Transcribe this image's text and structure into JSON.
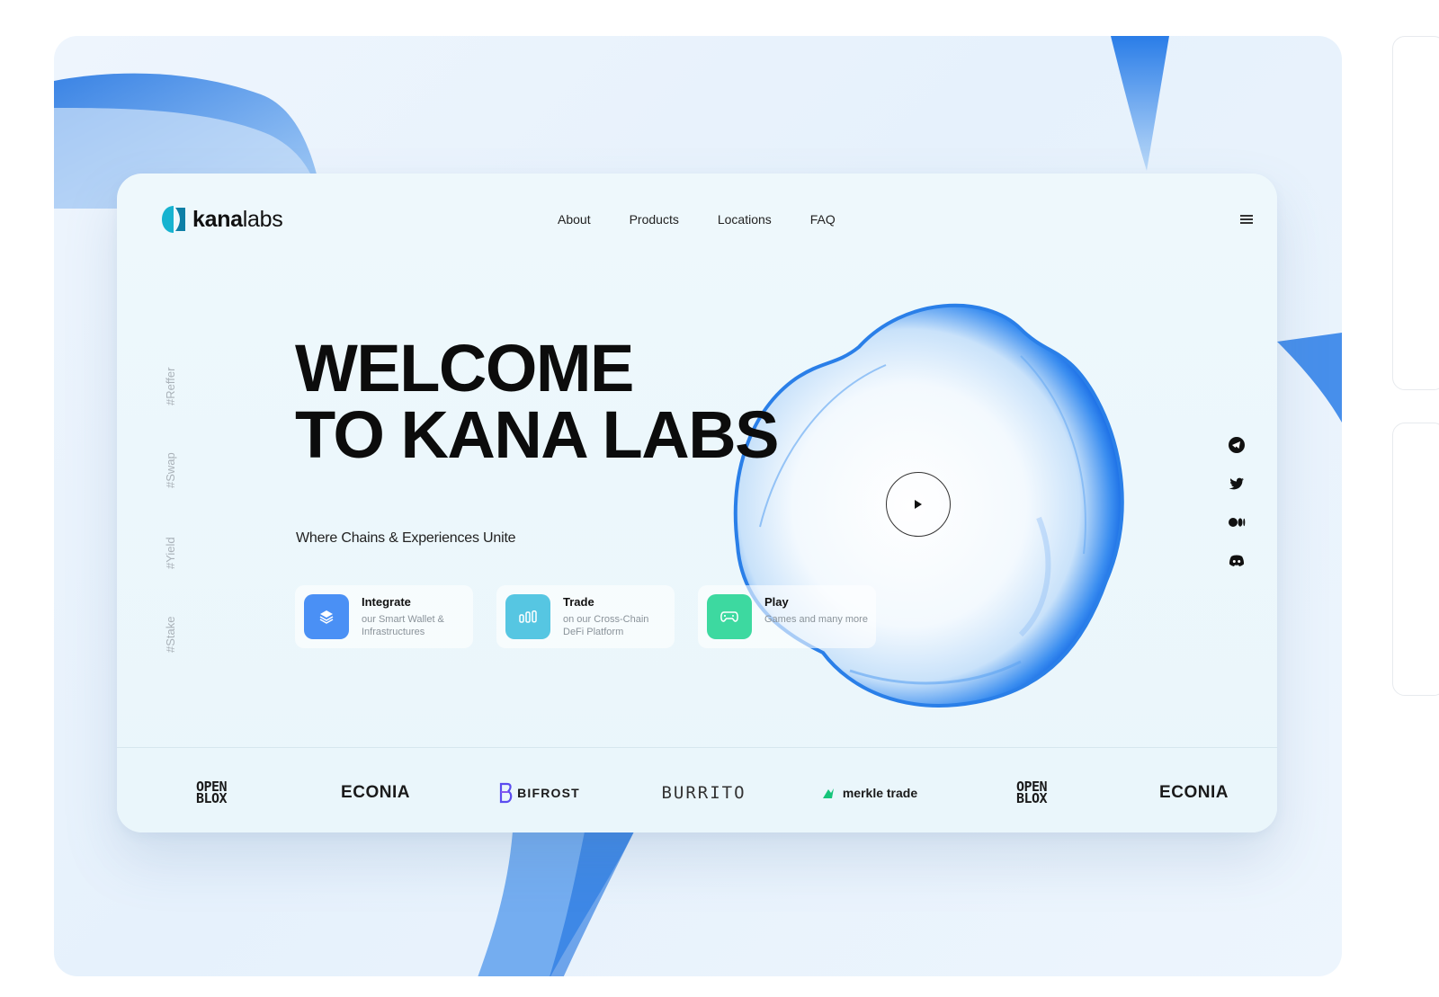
{
  "brand": {
    "name_bold": "kana",
    "name_light": "labs",
    "logo_color": "#14b8d4"
  },
  "nav": {
    "items": [
      "About",
      "Products",
      "Locations",
      "FAQ"
    ]
  },
  "hero": {
    "title_line1": "WELCOME",
    "title_line2": "TO KANA LABS",
    "subtitle": "Where Chains & Experiences Unite"
  },
  "vertical_tags": [
    "#Reffer",
    "#Swap",
    "#Yield",
    "#Stake"
  ],
  "features": [
    {
      "title": "Integrate",
      "desc": "our Smart Wallet & Infrastructures",
      "icon": "layers-icon",
      "color": "#4a90f5"
    },
    {
      "title": "Trade",
      "desc": "on our Cross-Chain DeFi Platform",
      "icon": "chart-icon",
      "color": "#56c6e2"
    },
    {
      "title": "Play",
      "desc": "Games and many more",
      "icon": "gamepad-icon",
      "color": "#3dd9a0"
    }
  ],
  "social": [
    "telegram-icon",
    "twitter-icon",
    "medium-icon",
    "discord-icon"
  ],
  "partners": {
    "openblox_l1": "OPEN",
    "openblox_l2": "BLOX",
    "econia": "ECONIA",
    "bifrost": "BIFROST",
    "burrito": "BURRITO",
    "merkle": "merkle trade"
  },
  "colors": {
    "accent_blue": "#1a73e8",
    "background": "#e8f3fc"
  }
}
